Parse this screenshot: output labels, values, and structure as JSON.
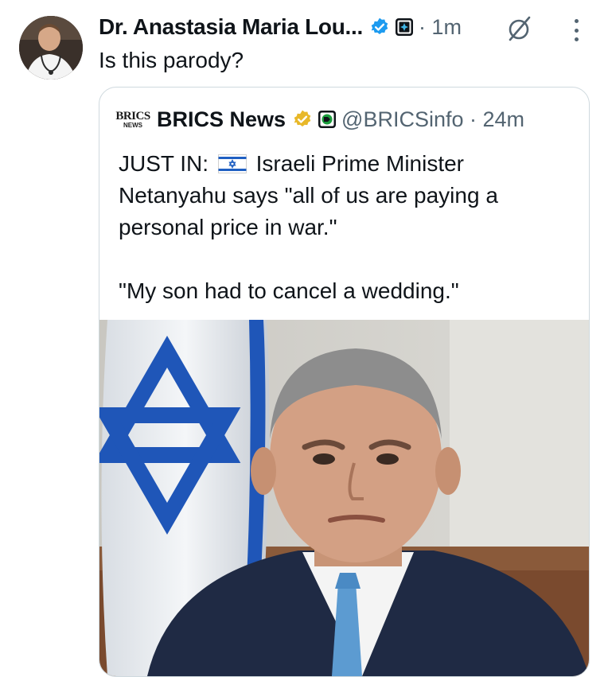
{
  "tweet": {
    "display_name": "Dr. Anastasia Maria Lou...",
    "time": "· 1m",
    "text": "Is this parody?"
  },
  "quote": {
    "name": "BRICS News",
    "handle": "@BRICSinfo · 24m",
    "logo_top": "BRICS",
    "logo_bottom": "NEWS",
    "line_prefix": "JUST IN:",
    "line_rest": "Israeli Prime Minister Netanyahu says \"all of us are paying a personal price in war.\"",
    "line_second": "\"My son had to cancel a wedding.\""
  },
  "colors": {
    "verified_blue": "#1d9bf0",
    "verified_gold": "#e8b829",
    "muted": "#536471",
    "border": "#cfd9de",
    "flag_blue": "#1f5fc2"
  },
  "icons": [
    "verified-badge-blue-icon",
    "affiliate-badge-icon",
    "grok-slash-icon",
    "more-options-icon",
    "verified-badge-gold-icon",
    "affiliation-badge-icon",
    "israel-flag-icon"
  ]
}
